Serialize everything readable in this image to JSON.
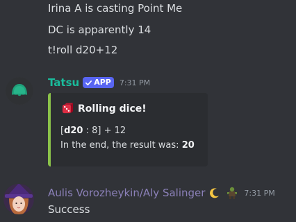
{
  "messages_top": [
    "Irina A is casting Point Me",
    "DC is apparently 14",
    "t!roll d20+12"
  ],
  "tatsu": {
    "username": "Tatsu",
    "username_color": "#1abc9c",
    "badge": "APP",
    "timestamp": "7:31 PM",
    "embed": {
      "title": "Rolling dice!",
      "die_label": "d20",
      "die_result": "8",
      "modifier": "+ 12",
      "result_prefix": "In the end, the result was:",
      "result_value": "20",
      "accent_color": "#8bc34a"
    }
  },
  "aulis": {
    "username": "Aulis Vorozheykin/Aly Salinger",
    "username_color": "#8b80b8",
    "timestamp": "7:31 PM",
    "text": "Success"
  },
  "icons": [
    "tatsu-avatar-icon",
    "check-icon",
    "dice-icon",
    "moon-icon",
    "goblin-icon",
    "witch-avatar-icon"
  ]
}
